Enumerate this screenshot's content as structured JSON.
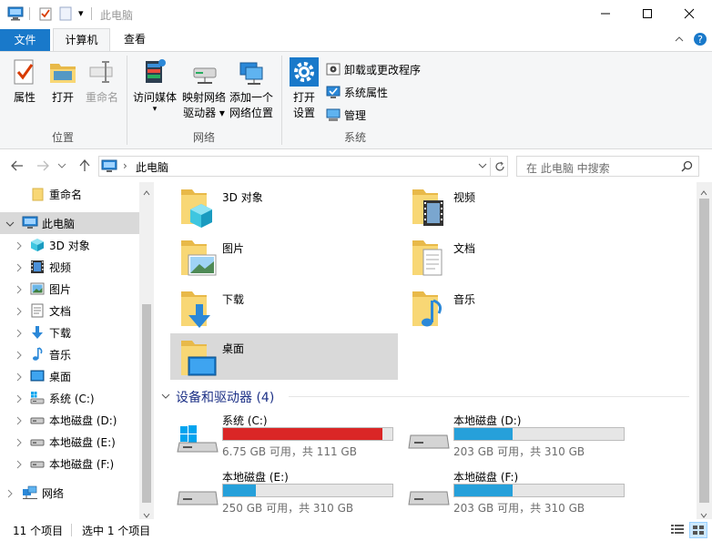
{
  "window": {
    "title": "此电脑",
    "qat_dropdown": "▾"
  },
  "ribbon_tabs": {
    "file": "文件",
    "computer": "计算机",
    "view": "查看"
  },
  "ribbon": {
    "groups": {
      "location": "位置",
      "network": "网络",
      "system": "系统"
    },
    "buttons": {
      "properties": "属性",
      "open": "打开",
      "rename": "重命名",
      "access_media_1": "访问媒体",
      "access_media_2": "▾",
      "map_drive_1": "映射网络",
      "map_drive_2": "驱动器 ▾",
      "add_location_1": "添加一个",
      "add_location_2": "网络位置",
      "open_settings_1": "打开",
      "open_settings_2": "设置"
    },
    "small_buttons": {
      "uninstall": "卸载或更改程序",
      "system_properties": "系统属性",
      "manage": "管理"
    }
  },
  "address": {
    "path": "此电脑",
    "separator": "›",
    "search_placeholder": "在 此电脑 中搜索"
  },
  "nav": {
    "items": [
      {
        "label": "重命名"
      },
      {
        "label": "此电脑"
      },
      {
        "label": "3D 对象"
      },
      {
        "label": "视频"
      },
      {
        "label": "图片"
      },
      {
        "label": "文档"
      },
      {
        "label": "下载"
      },
      {
        "label": "音乐"
      },
      {
        "label": "桌面"
      },
      {
        "label": "系统 (C:)"
      },
      {
        "label": "本地磁盘 (D:)"
      },
      {
        "label": "本地磁盘 (E:)"
      },
      {
        "label": "本地磁盘 (F:)"
      },
      {
        "label": "网络"
      }
    ]
  },
  "folders": [
    {
      "name": "3D 对象"
    },
    {
      "name": "视频"
    },
    {
      "name": "图片"
    },
    {
      "name": "文档"
    },
    {
      "name": "下载"
    },
    {
      "name": "音乐"
    },
    {
      "name": "桌面"
    }
  ],
  "drives_section": "设备和驱动器 (4)",
  "drives": [
    {
      "name": "系统 (C:)",
      "info": "6.75 GB 可用，共 111 GB",
      "used_fraction": 0.939,
      "color": "#da2626"
    },
    {
      "name": "本地磁盘 (D:)",
      "info": "203 GB 可用，共 310 GB",
      "used_fraction": 0.345,
      "color": "#26a0da"
    },
    {
      "name": "本地磁盘 (E:)",
      "info": "250 GB 可用，共 310 GB",
      "used_fraction": 0.194,
      "color": "#26a0da"
    },
    {
      "name": "本地磁盘 (F:)",
      "info": "203 GB 可用，共 310 GB",
      "used_fraction": 0.345,
      "color": "#26a0da"
    }
  ],
  "status": {
    "count": "11 个项目",
    "selected": "选中 1 个项目"
  },
  "colors": {
    "accent": "#1979ca",
    "selection": "#d9d9d9",
    "folder_yellow": "#f8d775",
    "section_blue": "#1e3287"
  }
}
